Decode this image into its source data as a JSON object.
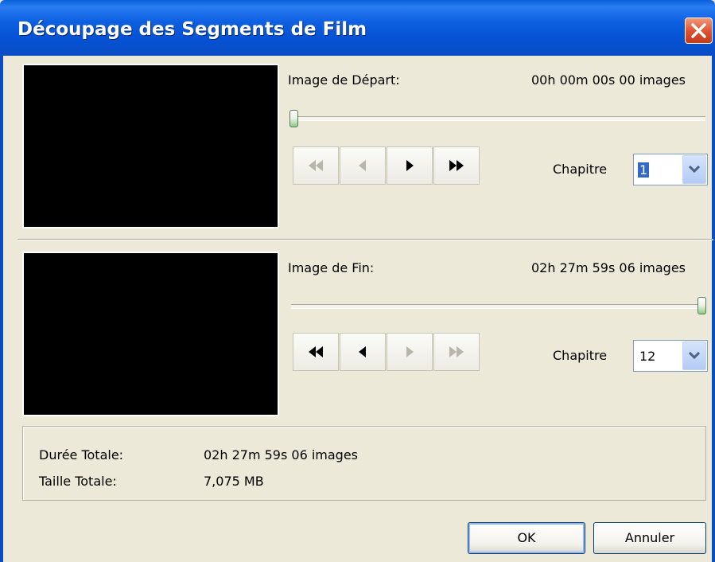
{
  "window": {
    "title": "Découpage des Segments de Film"
  },
  "start": {
    "label": "Image de Départ:",
    "time": "00h 00m 00s 00 images",
    "slider_position": 0,
    "chapter_label": "Chapitre",
    "chapter_value": "1"
  },
  "end": {
    "label": "Image de Fin:",
    "time": "02h 27m 59s 06 images",
    "slider_position": 1,
    "chapter_label": "Chapitre",
    "chapter_value": "12"
  },
  "summary": {
    "duration_label": "Durée Totale:",
    "duration_value": "02h 27m 59s 06 images",
    "size_label": "Taille Totale:",
    "size_value": "7,075 MB"
  },
  "buttons": {
    "ok": "OK",
    "cancel": "Annuler"
  },
  "colors": {
    "titlebar": "#0a5fd8",
    "close": "#dc5030",
    "face": "#ece9d8",
    "thumb": "#8ccc84"
  }
}
